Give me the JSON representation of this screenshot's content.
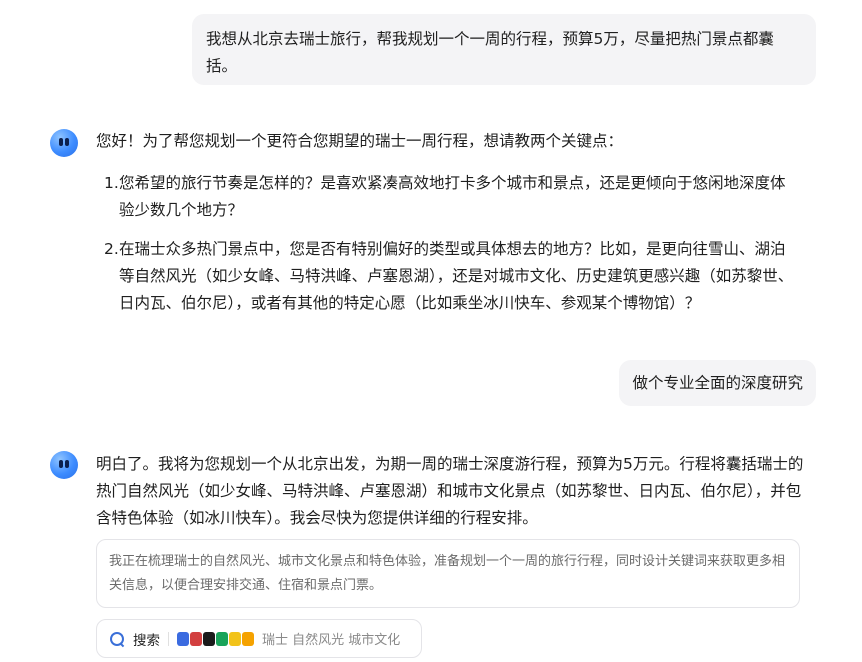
{
  "conversation": {
    "user_message_1": "我想从北京去瑞士旅行，帮我规划一个一周的行程，预算5万，尽量把热门景点都囊括。",
    "assistant_message_1": {
      "intro": "您好！为了帮您规划一个更符合您期望的瑞士一周行程，想请教两个关键点：",
      "questions": [
        {
          "num": "1.",
          "text": "您希望的旅行节奏是怎样的？是喜欢紧凑高效地打卡多个城市和景点，还是更倾向于悠闲地深度体验少数几个地方？"
        },
        {
          "num": "2.",
          "text": "在瑞士众多热门景点中，您是否有特别偏好的类型或具体想去的地方？比如，是更向往雪山、湖泊等自然风光（如少女峰、马特洪峰、卢塞恩湖），还是对城市文化、历史建筑更感兴趣（如苏黎世、日内瓦、伯尔尼），或者有其他的特定心愿（比如乘坐冰川快车、参观某个博物馆）？"
        }
      ]
    },
    "user_message_2": "做个专业全面的深度研究",
    "assistant_message_2": "明白了。我将为您规划一个从北京出发，为期一周的瑞士深度游行程，预算为5万元。行程将囊括瑞士的热门自然风光（如少女峰、马特洪峰、卢塞恩湖）和城市文化景点（如苏黎世、日内瓦、伯尔尼），并包含特色体验（如冰川快车）。我会尽快为您提供详细的行程安排。",
    "thinking_text": "我正在梳理瑞士的自然风光、城市文化景点和特色体验，准备规划一个一周的旅行行程，同时设计关键词来获取更多相关信息，以便合理安排交通、住宿和景点门票。",
    "search": {
      "label": "搜索",
      "keywords": "瑞士 自然风光 城市文化",
      "favicon_colors": [
        "#3b6be0",
        "#d23f3f",
        "#1b1b1b",
        "#19a35a",
        "#f2c31a",
        "#f5a200"
      ]
    }
  },
  "colors": {
    "user_bubble": "#f4f4f6",
    "accent": "#3a6fd8"
  }
}
